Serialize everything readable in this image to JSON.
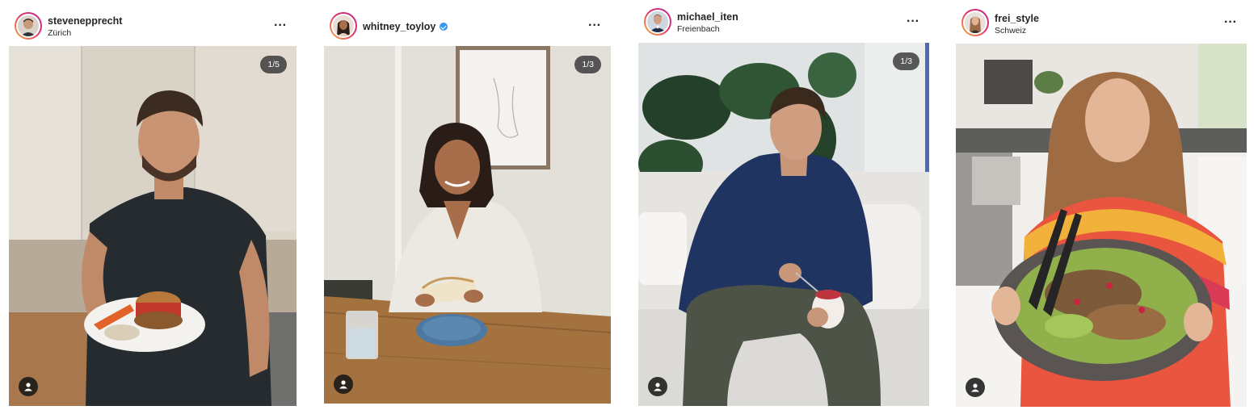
{
  "posts": [
    {
      "username": "stevenepprecht",
      "location": "Zürich",
      "verified": false,
      "more_label": "···",
      "counter": "1/5",
      "avatar_icon": "avatar-man-beard",
      "tag_icon": "user-tag-icon"
    },
    {
      "username": "whitney_toyloy",
      "location": "",
      "verified": true,
      "more_label": "···",
      "counter": "1/3",
      "avatar_icon": "avatar-woman-braids",
      "tag_icon": "user-tag-icon"
    },
    {
      "username": "michael_iten",
      "location": "Freienbach",
      "verified": false,
      "more_label": "···",
      "counter": "1/3",
      "avatar_icon": "avatar-man-suit",
      "tag_icon": "user-tag-icon"
    },
    {
      "username": "frei_style",
      "location": "Schweiz",
      "verified": false,
      "more_label": "···",
      "counter": "",
      "avatar_icon": "avatar-woman-long-hair",
      "tag_icon": "user-tag-icon"
    }
  ],
  "colors": {
    "text": "#262626",
    "verified_blue": "#3897f0",
    "story_ring_start": "#f7b239",
    "story_ring_end": "#b52a8f"
  }
}
